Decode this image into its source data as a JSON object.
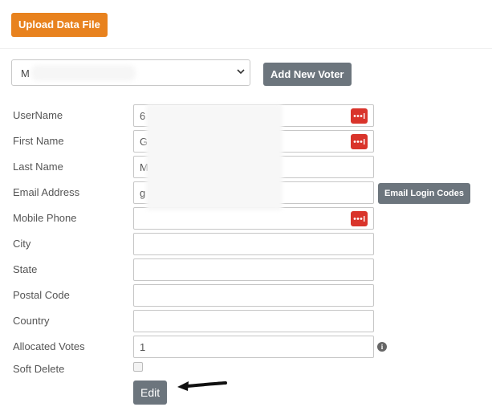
{
  "toolbar": {
    "upload_label": "Upload Data File"
  },
  "voter_selector": {
    "selected_value": "M",
    "add_voter_label": "Add New Voter"
  },
  "form": {
    "fields": [
      {
        "label": "UserName",
        "value": "6"
      },
      {
        "label": "First Name",
        "value": "G"
      },
      {
        "label": "Last Name",
        "value": "M"
      },
      {
        "label": "Email Address",
        "value": "g"
      },
      {
        "label": "Mobile Phone",
        "value": ""
      },
      {
        "label": "City",
        "value": ""
      },
      {
        "label": "State",
        "value": ""
      },
      {
        "label": "Postal Code",
        "value": ""
      },
      {
        "label": "Country",
        "value": ""
      },
      {
        "label": "Allocated Votes",
        "value": "1"
      }
    ],
    "soft_delete_label": "Soft Delete",
    "soft_delete_checked": false,
    "email_codes_label": "Email Login Codes",
    "info_icon_glyph": "i",
    "edit_label": "Edit"
  },
  "icons": {
    "password_manager": "password-dots-icon",
    "info": "info-icon",
    "select_chevron": "chevron-down-icon",
    "annotation": "arrow-left-icon"
  },
  "colors": {
    "upload_button": "#e8821e",
    "secondary_button": "#6c757d",
    "password_icon": "#d9342b"
  }
}
